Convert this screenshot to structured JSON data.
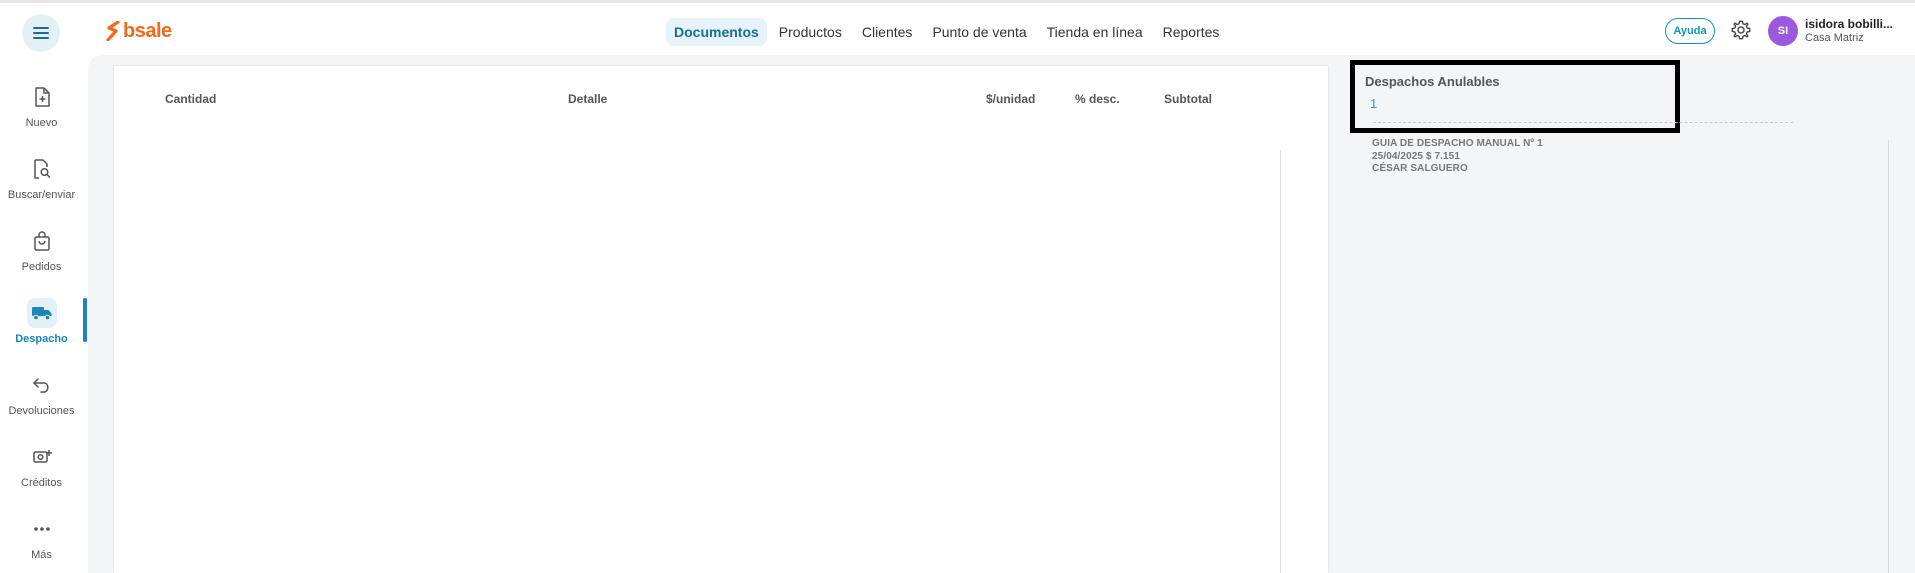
{
  "header": {
    "logo_text": "bsale",
    "nav": [
      {
        "label": "Documentos",
        "active": true
      },
      {
        "label": "Productos"
      },
      {
        "label": "Clientes"
      },
      {
        "label": "Punto de venta"
      },
      {
        "label": "Tienda en línea"
      },
      {
        "label": "Reportes"
      }
    ],
    "help_label": "Ayuda",
    "user": {
      "initials": "SI",
      "name": "isidora bobilli...",
      "branch": "Casa Matriz"
    }
  },
  "sidebar": {
    "items": [
      {
        "label": "Nuevo",
        "icon": "new-document-icon"
      },
      {
        "label": "Buscar/enviar",
        "icon": "search-document-icon"
      },
      {
        "label": "Pedidos",
        "icon": "shopping-bag-icon"
      },
      {
        "label": "Despacho",
        "icon": "truck-icon",
        "active": true
      },
      {
        "label": "Devoluciones",
        "icon": "return-arrow-icon"
      },
      {
        "label": "Créditos",
        "icon": "cash-icon"
      },
      {
        "label": "Más",
        "icon": "more-dots-icon"
      }
    ]
  },
  "table": {
    "columns": [
      "Cantidad",
      "Detalle",
      "$/unidad",
      "% desc.",
      "Subtotal"
    ]
  },
  "dispatch_panel": {
    "title": "Despachos Anulables",
    "count": "1",
    "entries": [
      {
        "line1": "GUIA DE DESPACHO MANUAL Nº 1",
        "line2": "25/04/2025 $ 7.151",
        "line3": "CÉSAR SALGUERO"
      }
    ]
  },
  "colors": {
    "accent": "#1a87b5",
    "brand": "#f26a1b",
    "avatar": "#9b59e0"
  }
}
